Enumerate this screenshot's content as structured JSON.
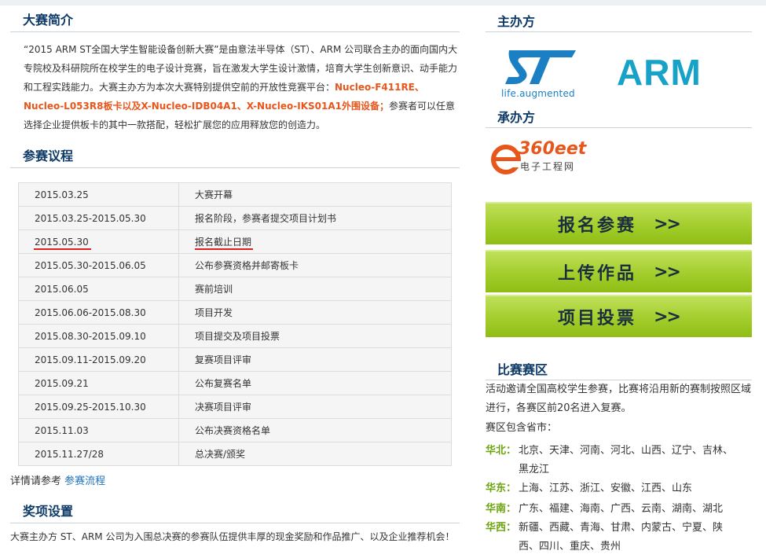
{
  "intro": {
    "title": "大赛简介",
    "text_before": "“2015 ARM ST全国大学生智能设备创新大赛”是由意法半导体（ST）、ARM 公司联合主办的面向国内大专院校及科研院所在校学生的电子设计竞赛，旨在激发大学生设计激情，培育大学生创新意识、动手能力和工程实践能力。大赛主办方为本次大赛特别提供空前的开放性竞赛平台：",
    "highlight": "Nucleo-F411RE、Nucleo-L053R8板卡以及X-Nucleo-IDB04A1、X-Nucleo-IKS01A1外围设备；",
    "text_after": "参赛者可以任意选择企业提供板卡的其中一款搭配，轻松扩展您的应用释放您的创造力。"
  },
  "schedule": {
    "title": "参赛议程",
    "rows": [
      {
        "date": "2015.03.25",
        "event": "大赛开幕"
      },
      {
        "date": "2015.03.25-2015.05.30",
        "event": "报名阶段，参赛者提交项目计划书"
      },
      {
        "date": "2015.05.30",
        "event": "报名截止日期"
      },
      {
        "date": "2015.05.30-2015.06.05",
        "event": "公布参赛资格并邮寄板卡"
      },
      {
        "date": "2015.06.05",
        "event": "赛前培训"
      },
      {
        "date": "2015.06.06-2015.08.30",
        "event": "项目开发"
      },
      {
        "date": "2015.08.30-2015.09.10",
        "event": "项目提交及项目投票"
      },
      {
        "date": "2015.09.11-2015.09.20",
        "event": "复赛项目评审"
      },
      {
        "date": "2015.09.21",
        "event": "公布复赛名单"
      },
      {
        "date": "2015.09.25-2015.10.30",
        "event": "决赛项目评审"
      },
      {
        "date": "2015.11.03",
        "event": "公布决赛资格名单"
      },
      {
        "date": "2015.11.27/28",
        "event": "总决赛/颁奖"
      }
    ],
    "more_prefix": "详情请参考",
    "more_link": "参赛流程"
  },
  "awards": {
    "title": "奖项设置",
    "text": "大赛主办方 ST、ARM 公司为入围总决赛的参赛队伍提供丰厚的现金奖励和作品推广、以及企业推荐机会！"
  },
  "sidebar": {
    "host_title": "主办方",
    "st_logo_text": "life.augmented",
    "arm_logo_text": "ARM",
    "organizer_title": "承办方",
    "eet_logo_main": "360eet",
    "eet_logo_sub": "电子工程网",
    "buttons": [
      {
        "label": "报名参赛",
        "arrow": ">>"
      },
      {
        "label": "上传作品",
        "arrow": ">>"
      },
      {
        "label": "项目投票",
        "arrow": ">>"
      }
    ],
    "region_title": "比赛赛区",
    "region_intro": "活动邀请全国高校学生参赛，比赛将沿用新的赛制按照区域进行，各赛区前20名进入复赛。",
    "region_sub": "赛区包含省市：",
    "regions": [
      {
        "name": "华北：",
        "list": "北京、天津、河南、河北、山西、辽宁、吉林、黑龙江"
      },
      {
        "name": "华东：",
        "list": "上海、江苏、浙江、安徽、江西、山东"
      },
      {
        "name": "华南：",
        "list": "广东、福建、海南、广西、云南、湖南、湖北"
      },
      {
        "name": "华西：",
        "list": "新疆、西藏、青海、甘肃、内蒙古、宁夏、陕西、四川、重庆、贵州"
      }
    ]
  },
  "colors": {
    "title": "#0d3a66",
    "highlight": "#e8561b",
    "link": "#1e73be",
    "button_green": "#a3cd2c",
    "region_green": "#6aa30c",
    "underline_red": "#e0201f"
  }
}
